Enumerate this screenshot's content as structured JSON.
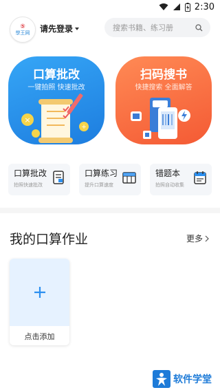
{
  "status_bar": {
    "time": "2:30"
  },
  "header": {
    "logo_text": "學王网",
    "login_label": "请先登录",
    "search_placeholder": "搜索书籍、练习册"
  },
  "big_cards": [
    {
      "title": "口算批改",
      "subtitle": "一键拍照 快速批改",
      "color": "#2b8ff0"
    },
    {
      "title": "扫码搜书",
      "subtitle": "快捷搜索 全面解答",
      "color": "#f66b3f"
    }
  ],
  "small_cards": [
    {
      "title": "口算批改",
      "subtitle": "拍照快速批改"
    },
    {
      "title": "口算练习",
      "subtitle": "提升口算速度"
    },
    {
      "title": "错题本",
      "subtitle": "拍照自动收集"
    }
  ],
  "section": {
    "title": "我的口算作业",
    "more_label": "更多",
    "add_label": "点击添加"
  },
  "watermark": {
    "text": "软件学堂"
  }
}
